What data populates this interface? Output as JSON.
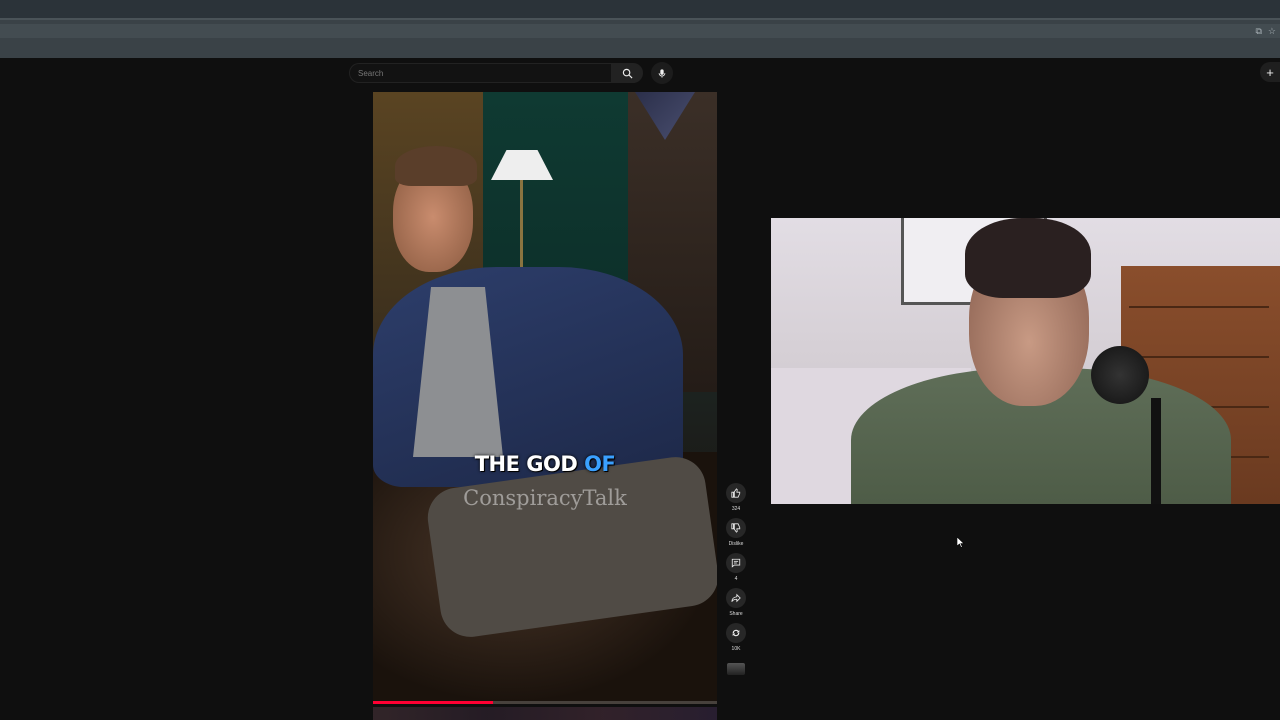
{
  "search": {
    "placeholder": "Search"
  },
  "short": {
    "caption_text": "THE GOD ",
    "caption_highlight": "OF",
    "watermark": "ConspiracyTalk",
    "progress": 0.35
  },
  "actions": {
    "like_count": "324",
    "dislike_label": "Dislike",
    "comment_count": "4",
    "share_label": "Share",
    "remix_count": "10K"
  },
  "colors": {
    "accent_red": "#ff0033",
    "caption_highlight": "#3aa0ff",
    "page_bg": "#0f0f0f"
  }
}
